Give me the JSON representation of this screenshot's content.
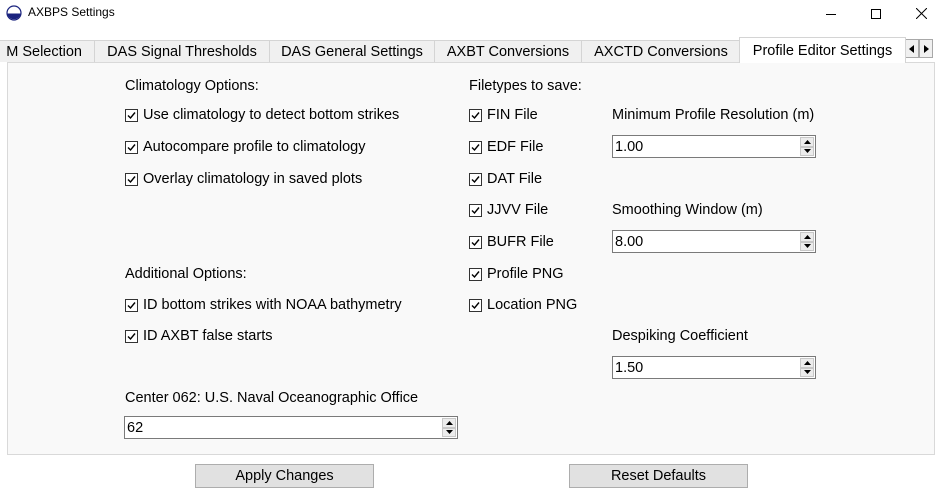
{
  "window": {
    "title": "AXBPS Settings"
  },
  "tabs": [
    {
      "label": "M Selection"
    },
    {
      "label": "DAS Signal Thresholds"
    },
    {
      "label": "DAS General Settings"
    },
    {
      "label": "AXBT Conversions"
    },
    {
      "label": "AXCTD Conversions"
    },
    {
      "label": "Profile Editor Settings",
      "active": true
    }
  ],
  "climatology": {
    "heading": "Climatology Options:",
    "options": [
      {
        "label": "Use climatology to detect bottom strikes",
        "checked": true
      },
      {
        "label": "Autocompare profile to climatology",
        "checked": true
      },
      {
        "label": "Overlay climatology in saved plots",
        "checked": true
      }
    ]
  },
  "additional": {
    "heading": "Additional Options:",
    "options": [
      {
        "label": "ID bottom strikes with NOAA bathymetry",
        "checked": true
      },
      {
        "label": "ID AXBT false starts",
        "checked": true
      }
    ]
  },
  "center": {
    "label": "Center 062: U.S. Naval Oceanographic Office",
    "value": "62"
  },
  "filetypes": {
    "heading": "Filetypes to save:",
    "options": [
      {
        "label": "FIN File",
        "checked": true
      },
      {
        "label": "EDF File",
        "checked": true
      },
      {
        "label": "DAT File",
        "checked": true
      },
      {
        "label": "JJVV File",
        "checked": true
      },
      {
        "label": "BUFR File",
        "checked": true
      },
      {
        "label": "Profile PNG",
        "checked": true
      },
      {
        "label": "Location PNG",
        "checked": true
      }
    ]
  },
  "resolution": {
    "label": "Minimum Profile Resolution (m)",
    "value": "1.00"
  },
  "smoothing": {
    "label": "Smoothing Window (m)",
    "value": "8.00"
  },
  "despiking": {
    "label": "Despiking Coefficient",
    "value": "1.50"
  },
  "buttons": {
    "apply": "Apply Changes",
    "reset": "Reset Defaults"
  }
}
